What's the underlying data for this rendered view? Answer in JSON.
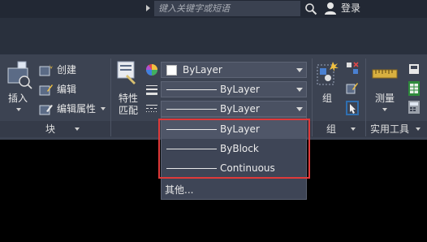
{
  "titlebar": {
    "search_placeholder": "键入关键字或短语",
    "login_label": "登录"
  },
  "ribbon": {
    "insert": {
      "label": "插入"
    },
    "block": {
      "create_label": "创建",
      "edit_label": "编辑",
      "edit_attributes_label": "编辑属性",
      "panel_title": "块"
    },
    "match_properties": {
      "line1": "特性",
      "line2": "匹配"
    },
    "properties": {
      "color_value": "ByLayer",
      "lineweight_value": "ByLayer",
      "linetype_value": "ByLayer"
    },
    "group": {
      "label": "组",
      "panel_title": "组"
    },
    "utilities": {
      "measure_label": "测量",
      "panel_title": "实用工具"
    }
  },
  "linetype_dropdown": {
    "options": [
      "ByLayer",
      "ByBlock",
      "Continuous"
    ],
    "selected": "ByLayer",
    "more_label": "其他..."
  },
  "colors": {
    "highlight_border": "#e03a3a",
    "ribbon_bg": "#3c4352",
    "titlebar_bg": "#222834"
  }
}
